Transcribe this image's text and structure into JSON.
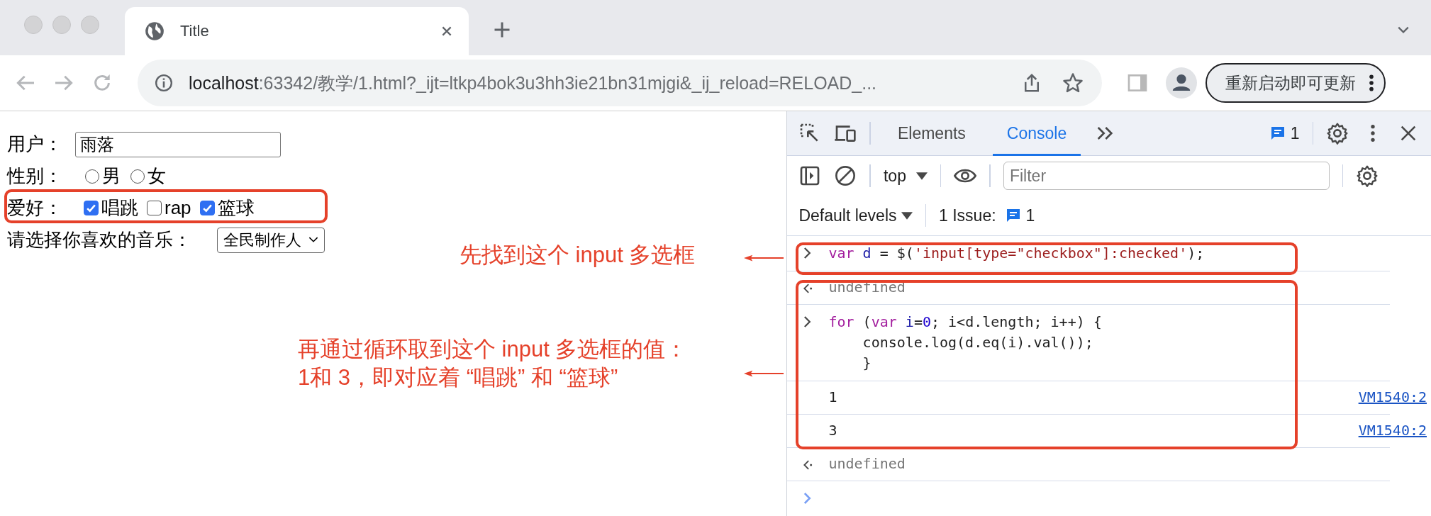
{
  "browser": {
    "tab": {
      "title": "Title"
    },
    "address": {
      "host": "localhost",
      "rest": ":63342/教学/1.html?_ijt=ltkp4bok3u3hh3ie21bn31mjgi&_ij_reload=RELOAD_..."
    },
    "update_button": "重新启动即可更新"
  },
  "form": {
    "user": {
      "label": "用户：",
      "value": "雨落"
    },
    "gender": {
      "label": "性别：",
      "options": [
        {
          "label": "男",
          "selected": false
        },
        {
          "label": "女",
          "selected": false
        }
      ]
    },
    "hobby": {
      "label": "爱好：",
      "options": [
        {
          "label": "唱跳",
          "checked": true
        },
        {
          "label": "rap",
          "checked": false
        },
        {
          "label": "篮球",
          "checked": true
        }
      ]
    },
    "music": {
      "label": "请选择你喜欢的音乐：",
      "value": "全民制作人"
    }
  },
  "devtools": {
    "tabs": [
      {
        "label": "Elements",
        "selected": false
      },
      {
        "label": "Console",
        "selected": true
      }
    ],
    "message_count": "1",
    "context": "top",
    "filter_placeholder": "Filter",
    "levels": "Default levels",
    "issues_label": "1 Issue:",
    "issues_count": "1",
    "console": [
      {
        "kind": "input",
        "lines": [
          [
            {
              "t": "var",
              "kind": "keyword"
            },
            {
              "t": " d",
              "kind": "variable"
            },
            {
              "t": " = $(",
              "kind": "plain"
            },
            {
              "t": "'input[type=\"checkbox\"]:checked'",
              "kind": "string"
            },
            {
              "t": ");",
              "kind": "plain"
            }
          ]
        ]
      },
      {
        "kind": "result",
        "text": "undefined"
      },
      {
        "kind": "input",
        "lines": [
          [
            {
              "t": "for",
              "kind": "keyword"
            },
            {
              "t": " (",
              "kind": "plain"
            },
            {
              "t": "var",
              "kind": "keyword"
            },
            {
              "t": " i",
              "kind": "variable"
            },
            {
              "t": "=",
              "kind": "plain"
            },
            {
              "t": "0",
              "kind": "number"
            },
            {
              "t": "; i<d.length; i++) {",
              "kind": "plain"
            }
          ],
          [
            {
              "t": "    console.log(d.eq(i).val());",
              "kind": "plain"
            }
          ],
          [
            {
              "t": "    }",
              "kind": "plain"
            }
          ]
        ]
      },
      {
        "kind": "log",
        "text": "1",
        "source": "VM1540:2"
      },
      {
        "kind": "log",
        "text": "3",
        "source": "VM1540:2"
      },
      {
        "kind": "result",
        "text": "undefined"
      },
      {
        "kind": "prompt"
      }
    ]
  },
  "annotations": [
    {
      "lines": [
        "先找到这个 input 多选框"
      ]
    },
    {
      "lines": [
        "再通过循环取到这个 input 多选框的值：",
        "1和 3，即对应着 “唱跳” 和 “篮球”"
      ]
    }
  ]
}
